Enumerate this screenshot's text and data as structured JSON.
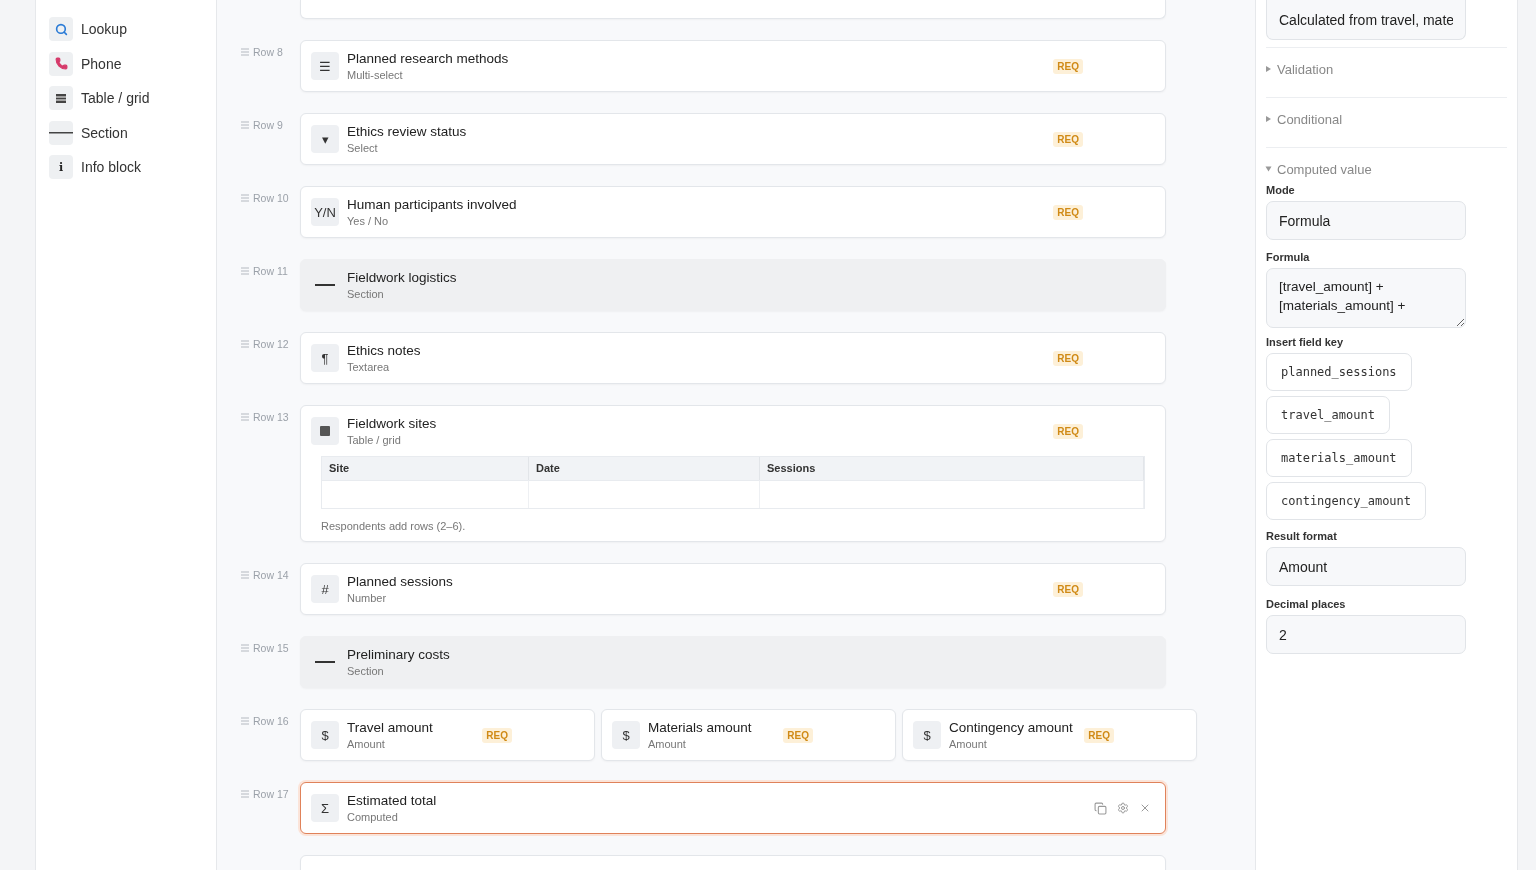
{
  "palette": {
    "items": [
      {
        "label": "Lookup",
        "kind": "search"
      },
      {
        "label": "Phone",
        "kind": "phone"
      },
      {
        "label": "Table / grid",
        "kind": "table"
      },
      {
        "label": "Section",
        "kind": "section"
      },
      {
        "label": "Info block",
        "kind": "info",
        "glyph": "i"
      }
    ]
  },
  "rows": [
    {
      "kind": "clipped"
    },
    {
      "kind": "single",
      "row_label": "Row 8",
      "fields": [
        {
          "title": "Planned research methods",
          "type_label": "Multi-select",
          "glyph": "☰",
          "badge": "REQ",
          "selected": false
        }
      ]
    },
    {
      "kind": "single",
      "row_label": "Row 9",
      "fields": [
        {
          "title": "Ethics review status",
          "type_label": "Select",
          "glyph": "▾",
          "badge": "REQ",
          "selected": false
        }
      ]
    },
    {
      "kind": "single",
      "row_label": "Row 10",
      "fields": [
        {
          "title": "Human participants involved",
          "type_label": "Yes / No",
          "glyph": "Y/N",
          "badge": "REQ",
          "selected": false
        }
      ]
    },
    {
      "kind": "section",
      "row_label": "Row 11",
      "fields": [
        {
          "title": "Fieldwork logistics",
          "type_label": "Section",
          "selected": false
        }
      ]
    },
    {
      "kind": "single",
      "row_label": "Row 12",
      "fields": [
        {
          "title": "Ethics notes",
          "type_label": "Textarea",
          "glyph": "¶",
          "badge": "REQ",
          "selected": false
        }
      ]
    },
    {
      "kind": "table",
      "row_label": "Row 13",
      "fields": [
        {
          "title": "Fieldwork sites",
          "type_label": "Table / grid",
          "badge": "REQ",
          "selected": false,
          "columns": [
            "Site",
            "Date",
            "Sessions"
          ],
          "note": "Respondents add rows (2–6)."
        }
      ]
    },
    {
      "kind": "single",
      "row_label": "Row 14",
      "fields": [
        {
          "title": "Planned sessions",
          "type_label": "Number",
          "glyph": "#",
          "badge": "REQ",
          "selected": false
        }
      ]
    },
    {
      "kind": "section",
      "row_label": "Row 15",
      "fields": [
        {
          "title": "Preliminary costs",
          "type_label": "Section",
          "selected": false
        }
      ]
    },
    {
      "kind": "group",
      "row_label": "Row 16",
      "fields": [
        {
          "title": "Travel amount",
          "type_label": "Amount",
          "glyph": "$",
          "badge": "REQ",
          "selected": false
        },
        {
          "title": "Materials amount",
          "type_label": "Amount",
          "glyph": "$",
          "badge": "REQ",
          "selected": false
        },
        {
          "title": "Contingency amount",
          "type_label": "Amount",
          "glyph": "$",
          "badge": "REQ",
          "selected": false
        }
      ]
    },
    {
      "kind": "single",
      "row_label": "Row 17",
      "fields": [
        {
          "title": "Estimated total",
          "type_label": "Computed",
          "glyph": "Σ",
          "selected": true
        }
      ]
    },
    {
      "kind": "empty"
    }
  ],
  "inspector": {
    "description_value": "Calculated from travel, mate",
    "sections": [
      {
        "title": "Validation",
        "expanded": false
      },
      {
        "title": "Conditional",
        "expanded": false
      },
      {
        "title": "Computed value",
        "expanded": true
      }
    ],
    "mode": {
      "label": "Mode",
      "value": "Formula"
    },
    "formula": {
      "label": "Formula",
      "value": "[travel_amount] +\n[materials_amount] +"
    },
    "insert_key": {
      "label": "Insert field key",
      "keys": [
        "planned_sessions",
        "travel_amount",
        "materials_amount",
        "contingency_amount"
      ]
    },
    "result_format": {
      "label": "Result format",
      "value": "Amount"
    },
    "decimal_places": {
      "label": "Decimal places",
      "value": "2"
    }
  }
}
